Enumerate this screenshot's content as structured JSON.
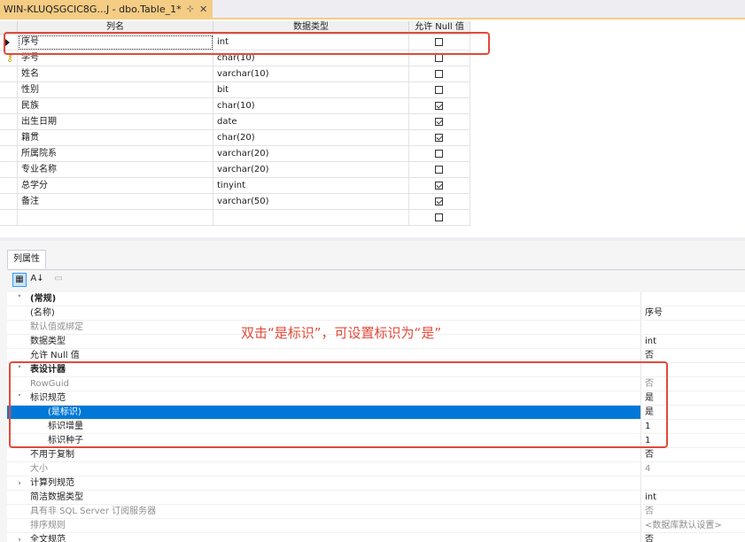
{
  "tab": {
    "title": "WIN-KLUQSGCIC8G...J - dbo.Table_1*",
    "pin": "⊹",
    "close": "✕"
  },
  "grid": {
    "headers": [
      "列名",
      "数据类型",
      "允许 Null 值"
    ],
    "rows": [
      {
        "name": "序号",
        "type": "int",
        "nullable": false
      },
      {
        "name": "学号",
        "type": "char(10)",
        "nullable": false
      },
      {
        "name": "姓名",
        "type": "varchar(10)",
        "nullable": false
      },
      {
        "name": "性别",
        "type": "bit",
        "nullable": false
      },
      {
        "name": "民族",
        "type": "char(10)",
        "nullable": true
      },
      {
        "name": "出生日期",
        "type": "date",
        "nullable": true
      },
      {
        "name": "籍贯",
        "type": "char(20)",
        "nullable": true
      },
      {
        "name": "所属院系",
        "type": "varchar(20)",
        "nullable": false
      },
      {
        "name": "专业名称",
        "type": "varchar(20)",
        "nullable": false
      },
      {
        "name": "总学分",
        "type": "tinyint",
        "nullable": true
      },
      {
        "name": "备注",
        "type": "varchar(50)",
        "nullable": true
      },
      {
        "name": "",
        "type": "",
        "nullable": false
      }
    ]
  },
  "props": {
    "tab_label": "列属性",
    "toolbar": {
      "categorized": "▦",
      "alpha": "A↓",
      "pages": "▭"
    },
    "rows": [
      {
        "name": "(常规)",
        "value": "",
        "kind": "cat",
        "expander": "˅",
        "indent": 0
      },
      {
        "name": "(名称)",
        "value": "序号",
        "kind": "normal",
        "expander": "",
        "indent": 1
      },
      {
        "name": "默认值或绑定",
        "value": "",
        "kind": "gray",
        "expander": "",
        "indent": 1
      },
      {
        "name": "数据类型",
        "value": "int",
        "kind": "normal",
        "expander": "",
        "indent": 1
      },
      {
        "name": "允许 Null 值",
        "value": "否",
        "kind": "normal",
        "expander": "",
        "indent": 1
      },
      {
        "name": "表设计器",
        "value": "",
        "kind": "cat",
        "expander": "˅",
        "indent": 0
      },
      {
        "name": "RowGuid",
        "value": "否",
        "kind": "gray",
        "expander": "",
        "indent": 1
      },
      {
        "name": "标识规范",
        "value": "是",
        "kind": "normal",
        "expander": "˅",
        "indent": 1
      },
      {
        "name": "(是标识)",
        "value": "是",
        "kind": "sel",
        "expander": "",
        "indent": 2
      },
      {
        "name": "标识增量",
        "value": "1",
        "kind": "normal",
        "expander": "",
        "indent": 2
      },
      {
        "name": "标识种子",
        "value": "1",
        "kind": "normal",
        "expander": "",
        "indent": 2
      },
      {
        "name": "不用于复制",
        "value": "否",
        "kind": "normal",
        "expander": "",
        "indent": 1
      },
      {
        "name": "大小",
        "value": "4",
        "kind": "gray",
        "expander": "",
        "indent": 1
      },
      {
        "name": "计算列规范",
        "value": "",
        "kind": "normal",
        "expander": "›",
        "indent": 1
      },
      {
        "name": "简洁数据类型",
        "value": "int",
        "kind": "normal",
        "expander": "",
        "indent": 1
      },
      {
        "name": "具有非 SQL Server 订阅服务器",
        "value": "否",
        "kind": "gray",
        "expander": "",
        "indent": 1
      },
      {
        "name": "排序规则",
        "value": "<数据库默认设置>",
        "kind": "gray",
        "expander": "",
        "indent": 1
      },
      {
        "name": "全文规范",
        "value": "否",
        "kind": "normal",
        "expander": "›",
        "indent": 1
      }
    ]
  },
  "annotation": "双击“是标识”，可设置标识为“是”",
  "colors": {
    "accent": "#0078d7",
    "annotation": "#e24a3a",
    "tab": "#f5cc84"
  }
}
